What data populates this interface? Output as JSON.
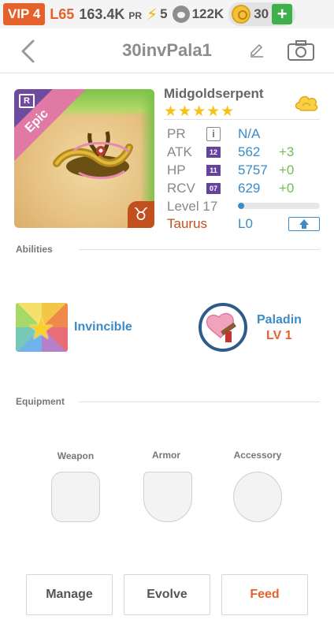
{
  "status_bar": {
    "vip": "VIP 4",
    "level": "L65",
    "power": "163.4K",
    "power_unit": "PR",
    "energy": "5",
    "food": "122K",
    "gold": "30"
  },
  "header": {
    "title": "30invPala1"
  },
  "monster": {
    "name": "Midgoldserpent",
    "stars": "★★★★★",
    "rarity_badge": "R",
    "rarity": "Epic",
    "zodiac_symbol": "♉",
    "stats": {
      "pr": {
        "label": "PR",
        "value": "N/A"
      },
      "atk": {
        "label": "ATK",
        "rank": "12",
        "value": "562",
        "bonus": "+3"
      },
      "hp": {
        "label": "HP",
        "rank": "11",
        "value": "5757",
        "bonus": "+0"
      },
      "rcv": {
        "label": "RCV",
        "rank": "07",
        "value": "629",
        "bonus": "+0"
      }
    },
    "level_label": "Level 17",
    "level_progress_pct": 8,
    "zodiac": "Taurus",
    "limit": "L0"
  },
  "abilities": {
    "title": "Abilities",
    "ability_name": "Invincible",
    "class_name": "Paladin",
    "class_level": "LV 1"
  },
  "equipment": {
    "title": "Equipment",
    "weapon": "Weapon",
    "armor": "Armor",
    "accessory": "Accessory"
  },
  "actions": {
    "manage": "Manage",
    "evolve": "Evolve",
    "feed": "Feed"
  },
  "colors": {
    "accent_orange": "#e5622c",
    "accent_blue": "#3c8bc7",
    "bonus_green": "#6fbe50",
    "star_yellow": "#f6c21a",
    "rank_purple": "#63449a"
  }
}
